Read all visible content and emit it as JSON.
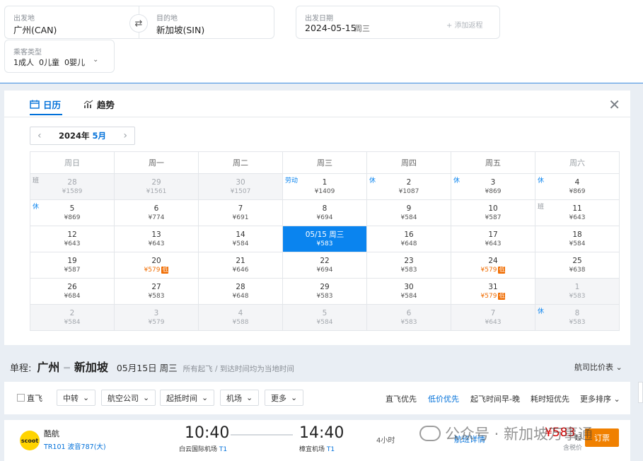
{
  "search": {
    "from_label": "出发地",
    "from_value": "广州(CAN)",
    "to_label": "目的地",
    "to_value": "新加坡(SIN)",
    "date_label": "出发日期",
    "date_value": "2024-05-15",
    "date_weekday": "周三",
    "add_return": "+ 添加返程",
    "passenger_label": "乘客类型",
    "passenger_adult": "1成人",
    "passenger_child": "0儿童",
    "passenger_infant": "0婴儿"
  },
  "calendar": {
    "tab_calendar": "日历",
    "tab_trend": "趋势",
    "year": "2024年",
    "month": "5月",
    "weekdays": [
      "周日",
      "周一",
      "周二",
      "周三",
      "周四",
      "周五",
      "周六"
    ],
    "weeks": [
      [
        {
          "day": "28",
          "price": "¥1589",
          "off": true,
          "badge": "班"
        },
        {
          "day": "29",
          "price": "¥1561",
          "off": true
        },
        {
          "day": "30",
          "price": "¥1507",
          "off": true
        },
        {
          "day": "1",
          "price": "¥1409",
          "badge": "劳动"
        },
        {
          "day": "2",
          "price": "¥1087",
          "badge": "休"
        },
        {
          "day": "3",
          "price": "¥869",
          "badge": "休"
        },
        {
          "day": "4",
          "price": "¥869",
          "badge": "休"
        }
      ],
      [
        {
          "day": "5",
          "price": "¥869",
          "badge": "休"
        },
        {
          "day": "6",
          "price": "¥774"
        },
        {
          "day": "7",
          "price": "¥691"
        },
        {
          "day": "8",
          "price": "¥694"
        },
        {
          "day": "9",
          "price": "¥584"
        },
        {
          "day": "10",
          "price": "¥587"
        },
        {
          "day": "11",
          "price": "¥643",
          "badge": "班"
        }
      ],
      [
        {
          "day": "12",
          "price": "¥643"
        },
        {
          "day": "13",
          "price": "¥643"
        },
        {
          "day": "14",
          "price": "¥584"
        },
        {
          "day": "05/15 周三",
          "price": "¥583",
          "selected": true
        },
        {
          "day": "16",
          "price": "¥648"
        },
        {
          "day": "17",
          "price": "¥643"
        },
        {
          "day": "18",
          "price": "¥584"
        }
      ],
      [
        {
          "day": "19",
          "price": "¥587"
        },
        {
          "day": "20",
          "price": "¥579",
          "low": true
        },
        {
          "day": "21",
          "price": "¥646"
        },
        {
          "day": "22",
          "price": "¥694"
        },
        {
          "day": "23",
          "price": "¥583"
        },
        {
          "day": "24",
          "price": "¥579",
          "low": true
        },
        {
          "day": "25",
          "price": "¥638"
        }
      ],
      [
        {
          "day": "26",
          "price": "¥684"
        },
        {
          "day": "27",
          "price": "¥583"
        },
        {
          "day": "28",
          "price": "¥648"
        },
        {
          "day": "29",
          "price": "¥583"
        },
        {
          "day": "30",
          "price": "¥584"
        },
        {
          "day": "31",
          "price": "¥579",
          "low": true
        },
        {
          "day": "1",
          "price": "¥583",
          "off": true
        }
      ],
      [
        {
          "day": "2",
          "price": "¥584",
          "off": true
        },
        {
          "day": "3",
          "price": "¥579",
          "off": true
        },
        {
          "day": "4",
          "price": "¥588",
          "off": true
        },
        {
          "day": "5",
          "price": "¥584",
          "off": true
        },
        {
          "day": "6",
          "price": "¥583",
          "off": true
        },
        {
          "day": "7",
          "price": "¥643",
          "off": true
        },
        {
          "day": "8",
          "price": "¥583",
          "off": true,
          "badge": "休"
        }
      ]
    ],
    "low_tag": "低"
  },
  "route": {
    "kind": "单程:",
    "from_city": "广州",
    "to_city": "新加坡",
    "date": "05月15日 周三",
    "note": "所有起飞 / 到达时间均为当地时间",
    "compare": "航司比价表"
  },
  "filters": {
    "direct": "直飞",
    "buttons": [
      "中转",
      "航空公司",
      "起抵时间",
      "机场",
      "更多"
    ],
    "sorts": [
      "直飞优先",
      "低价优先",
      "起飞时间早-晚",
      "耗时短优先",
      "更多排序"
    ],
    "active_sort": "低价优先"
  },
  "flight": {
    "logo_text": "scoot",
    "airline": "酷航",
    "flight_no": "TR101 波音787(大)",
    "dep_time": "10:40",
    "dep_airport": "白云国际机场",
    "dep_terminal": "T1",
    "arr_time": "14:40",
    "arr_airport": "樟宜机场",
    "arr_terminal": "T1",
    "duration": "4小时",
    "details": "航班详情",
    "price": "¥583",
    "price_suffix": "起",
    "tax_note": "含税价",
    "book": "订票"
  },
  "watermark": "公众号 · 新加坡万事通"
}
